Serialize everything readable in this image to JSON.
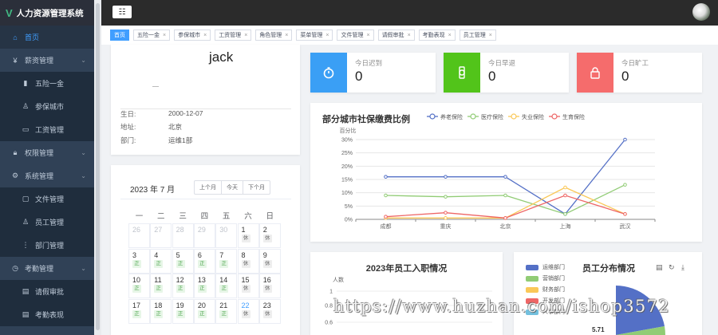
{
  "app": {
    "title": "人力资源管理系统",
    "logo_letter": "V"
  },
  "sidebar": {
    "items": [
      {
        "label": "首页",
        "icon": "home-icon",
        "level": "top",
        "active": true
      },
      {
        "label": "薪资管理",
        "icon": "money-icon",
        "level": "top",
        "expandable": true
      },
      {
        "label": "五险一金",
        "icon": "chart-icon",
        "level": "sub"
      },
      {
        "label": "参保城市",
        "icon": "user-icon",
        "level": "sub"
      },
      {
        "label": "工资管理",
        "icon": "monitor-icon",
        "level": "sub"
      },
      {
        "label": "权限管理",
        "icon": "lock-icon",
        "level": "top",
        "expandable": true
      },
      {
        "label": "系统管理",
        "icon": "gear-icon",
        "level": "top",
        "expandable": true
      },
      {
        "label": "文件管理",
        "icon": "folder-icon",
        "level": "sub"
      },
      {
        "label": "员工管理",
        "icon": "user-icon",
        "level": "sub"
      },
      {
        "label": "部门管理",
        "icon": "tree-icon",
        "level": "sub"
      },
      {
        "label": "考勤管理",
        "icon": "clock-icon",
        "level": "top",
        "expandable": true
      },
      {
        "label": "请假审批",
        "icon": "document-icon",
        "level": "sub"
      },
      {
        "label": "考勤表现",
        "icon": "document-icon",
        "level": "sub"
      }
    ]
  },
  "tags": [
    {
      "label": "首页",
      "active": true
    },
    {
      "label": "五险一金"
    },
    {
      "label": "参保城市"
    },
    {
      "label": "工资管理"
    },
    {
      "label": "角色管理"
    },
    {
      "label": "菜单管理"
    },
    {
      "label": "文件管理"
    },
    {
      "label": "请假审批"
    },
    {
      "label": "考勤表现"
    },
    {
      "label": "员工管理"
    }
  ],
  "profile": {
    "name": "jack",
    "birthday_label": "生日:",
    "birthday": "2000-12-07",
    "address_label": "地址:",
    "address": "北京",
    "dept_label": "部门:",
    "dept": "运维1部"
  },
  "calendar": {
    "title": "2023 年 7 月",
    "buttons": [
      "上个月",
      "今天",
      "下个月"
    ],
    "weekdays": [
      "一",
      "二",
      "三",
      "四",
      "五",
      "六",
      "日"
    ],
    "rows": [
      [
        {
          "d": "26",
          "prev": true
        },
        {
          "d": "27",
          "prev": true
        },
        {
          "d": "28",
          "prev": true
        },
        {
          "d": "29",
          "prev": true
        },
        {
          "d": "30",
          "prev": true
        },
        {
          "d": "1",
          "tag": "休"
        },
        {
          "d": "2",
          "tag": "休"
        }
      ],
      [
        {
          "d": "3",
          "tag": "正"
        },
        {
          "d": "4",
          "tag": "正"
        },
        {
          "d": "5",
          "tag": "正"
        },
        {
          "d": "6",
          "tag": "正"
        },
        {
          "d": "7",
          "tag": "正"
        },
        {
          "d": "8",
          "tag": "休"
        },
        {
          "d": "9",
          "tag": "休"
        }
      ],
      [
        {
          "d": "10",
          "tag": "正"
        },
        {
          "d": "11",
          "tag": "正"
        },
        {
          "d": "12",
          "tag": "正"
        },
        {
          "d": "13",
          "tag": "正"
        },
        {
          "d": "14",
          "tag": "正"
        },
        {
          "d": "15",
          "tag": "休"
        },
        {
          "d": "16",
          "tag": "休"
        }
      ],
      [
        {
          "d": "17",
          "tag": "正"
        },
        {
          "d": "18",
          "tag": "正"
        },
        {
          "d": "19",
          "tag": "正"
        },
        {
          "d": "20",
          "tag": "正"
        },
        {
          "d": "21",
          "tag": "正"
        },
        {
          "d": "22",
          "tag": "休",
          "today": true
        },
        {
          "d": "23",
          "tag": "休"
        }
      ]
    ]
  },
  "stats": [
    {
      "label": "今日迟到",
      "value": "0",
      "color": "#3a9ff5",
      "icon": "stopwatch-icon"
    },
    {
      "label": "今日早退",
      "value": "0",
      "color": "#52c41a",
      "icon": "watch-icon"
    },
    {
      "label": "今日旷工",
      "value": "0",
      "color": "#f56c6c",
      "icon": "lock-icon"
    }
  ],
  "chart_data": [
    {
      "type": "line",
      "title": "部分城市社保缴费比例",
      "ylabel": "百分比",
      "categories": [
        "成都",
        "重庆",
        "北京",
        "上海",
        "武汉"
      ],
      "y_ticks": [
        "0%",
        "5%",
        "10%",
        "15%",
        "20%",
        "25%",
        "30%"
      ],
      "ylim": [
        0,
        30
      ],
      "series": [
        {
          "name": "养老保险",
          "color": "#5470c6",
          "values": [
            16,
            16,
            16,
            2,
            30
          ]
        },
        {
          "name": "医疗保险",
          "color": "#91cc75",
          "values": [
            9,
            8.5,
            9,
            2,
            13
          ]
        },
        {
          "name": "失业保险",
          "color": "#fac858",
          "values": [
            0.5,
            0.5,
            0.5,
            12,
            2
          ]
        },
        {
          "name": "生育保险",
          "color": "#ee6666",
          "values": [
            1,
            2.5,
            0.5,
            9,
            2
          ]
        }
      ]
    },
    {
      "type": "line",
      "title": "2023年员工入职情况",
      "ylabel": "人数",
      "y_ticks": [
        "1",
        "0.8",
        "0.6"
      ]
    },
    {
      "type": "pie",
      "title": "员工分布情况",
      "legend": [
        {
          "name": "运维部门",
          "color": "#5470c6"
        },
        {
          "name": "营销部门",
          "color": "#91cc75"
        },
        {
          "name": "财务部门",
          "color": "#fac858"
        },
        {
          "name": "开发部门",
          "color": "#ee6666"
        },
        {
          "name": "人事部门",
          "color": "#73c0de"
        }
      ],
      "visible_label": "5.71"
    }
  ],
  "watermark": "https://www.huzhan.com/ishop3572"
}
